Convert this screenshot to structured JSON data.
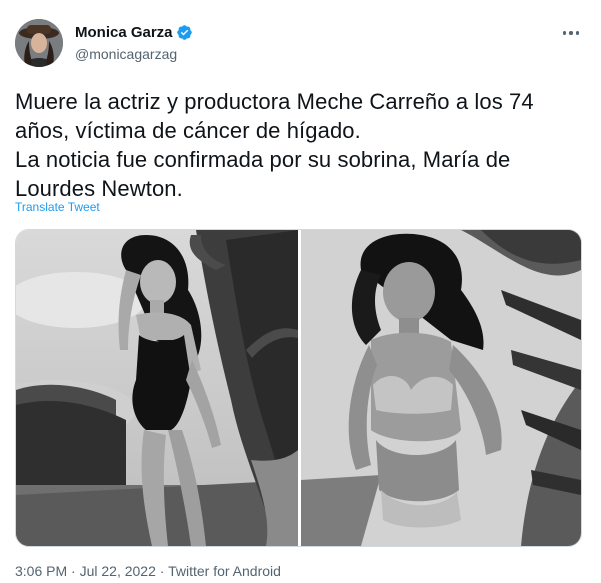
{
  "author": {
    "display_name": "Monica Garza",
    "handle": "@monicagarzag",
    "verified": true,
    "avatar_icon": "profile-photo"
  },
  "tweet": {
    "text_lines": [
      "Muere la actriz y productora Meche Carreño a los 74",
      "años, víctima de cáncer de hígado.",
      "La noticia fue confirmada por su sobrina, María de",
      "Lourdes Newton."
    ],
    "translate_label": "Translate Tweet"
  },
  "media": {
    "photos": [
      {
        "description_icon": "photo-left"
      },
      {
        "description_icon": "photo-right"
      }
    ]
  },
  "meta": {
    "time": "3:06 PM",
    "date": "Jul 22, 2022",
    "source": "Twitter for Android",
    "separator": " · "
  },
  "colors": {
    "link": "#1d9bf0",
    "secondary_text": "#536471",
    "primary_text": "#0f1419",
    "verified_badge": "#1d9bf0"
  }
}
